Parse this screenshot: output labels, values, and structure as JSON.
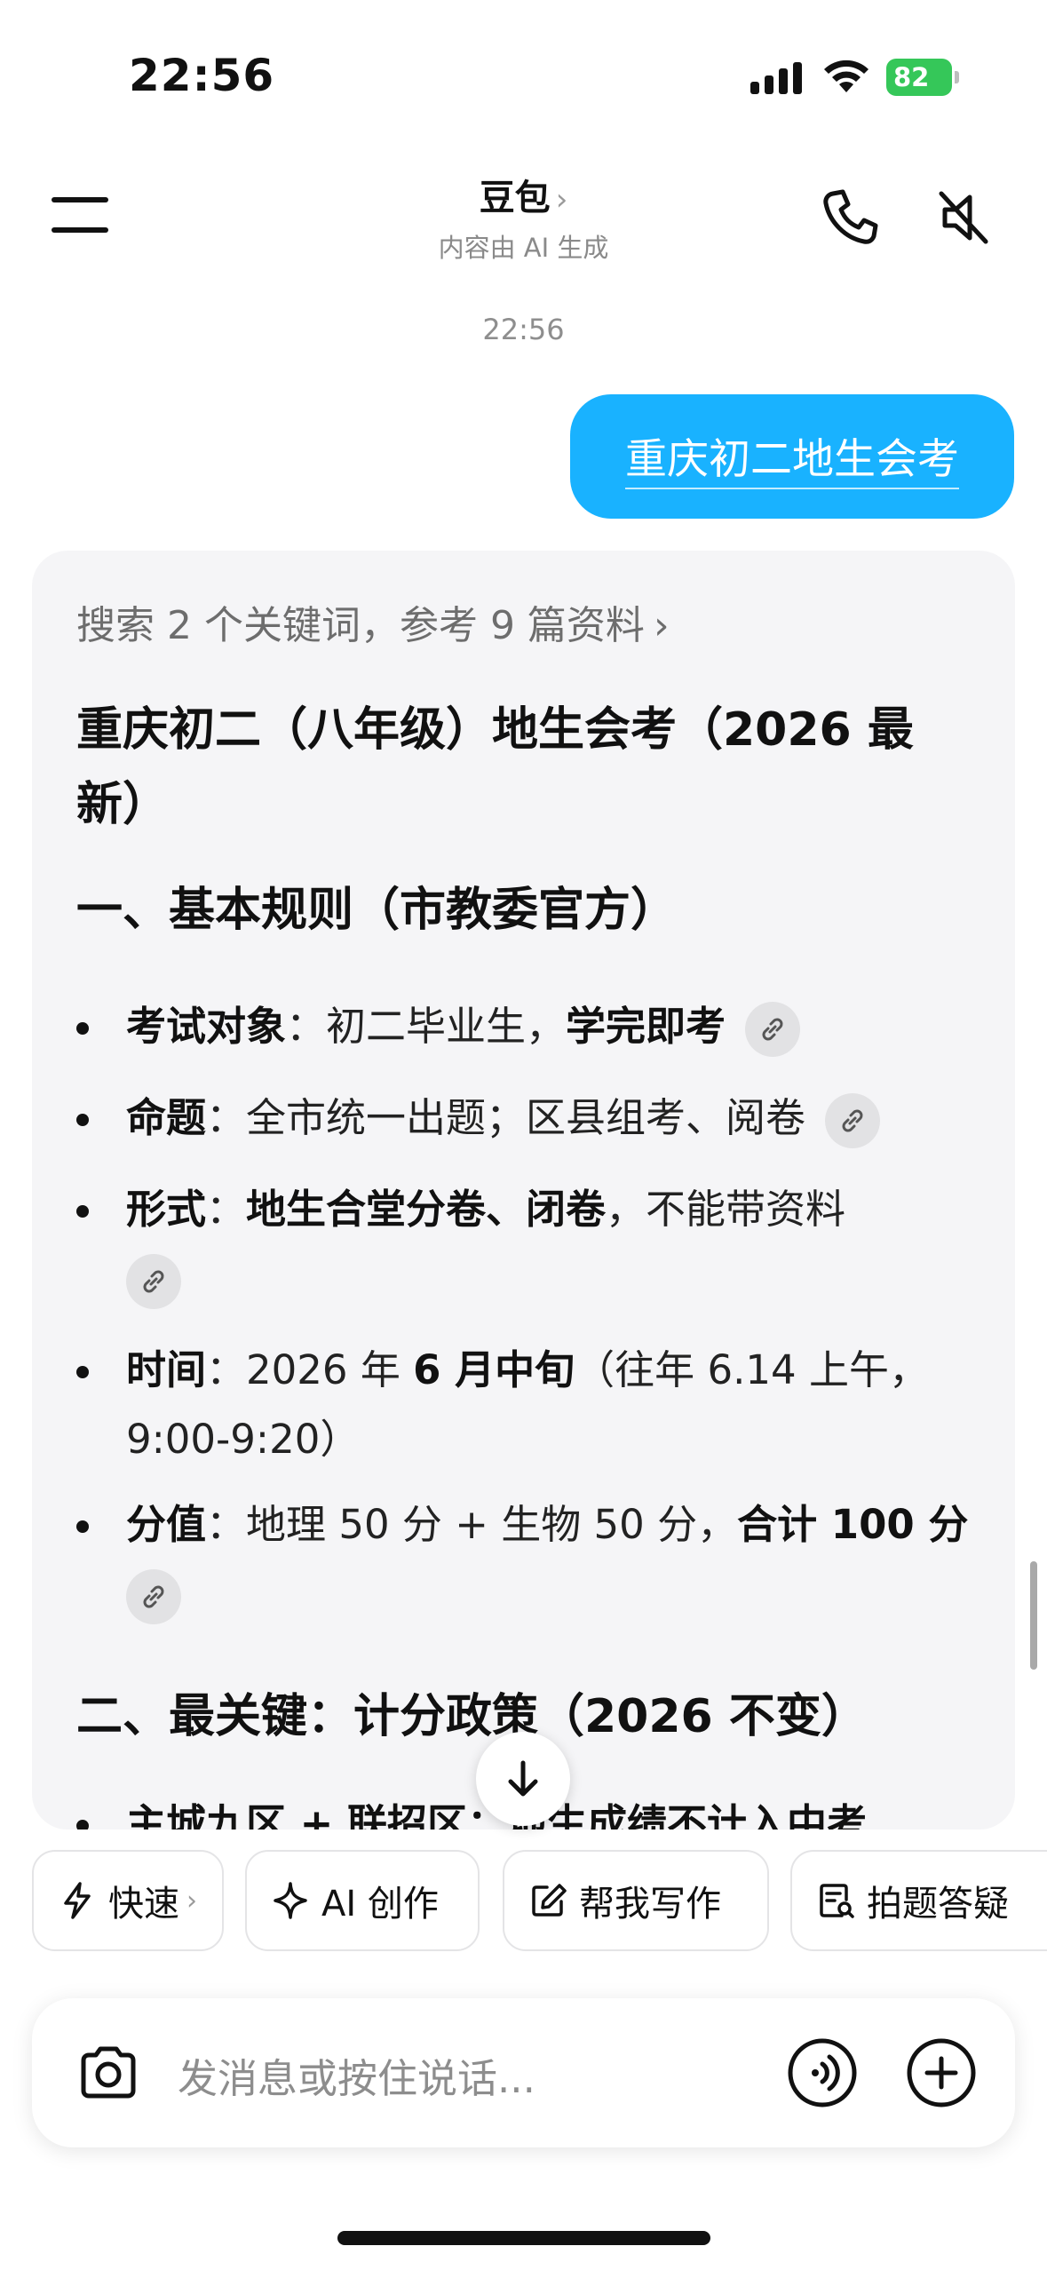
{
  "status_bar": {
    "time": "22:56",
    "battery": "82"
  },
  "header": {
    "title": "豆包",
    "title_chevron": "›",
    "subtitle": "内容由 AI 生成",
    "icons": [
      "menu-icon",
      "phone-icon",
      "mute-icon"
    ]
  },
  "chat": {
    "timestamp": "22:56",
    "user_message": "重庆初二地生会考",
    "answer": {
      "search_ref": "搜索 2 个关键词，参考 9 篇资料",
      "search_ref_chevron": "›",
      "heading": "重庆初二（八年级）地生会考（2026 最新）",
      "section1": "一、基本规则（市教委官方）",
      "bullets": [
        {
          "label": "考试对象",
          "sep": "：",
          "text1": "初二毕业生，",
          "bold1": "学完即考",
          "text2": ""
        },
        {
          "label": "命题",
          "sep": "：",
          "text1": "全市统一出题；区县组考、阅卷",
          "bold1": "",
          "text2": ""
        },
        {
          "label": "形式",
          "sep": "：",
          "text1": "",
          "bold1": "地生合堂分卷、闭卷",
          "text2": "，不能带资料"
        },
        {
          "label": "时间",
          "sep": "：",
          "text1": "2026 年 ",
          "bold1": "6 月中旬",
          "text2": "（往年 6.14 上午，9:00-9:20）"
        },
        {
          "label": "分值",
          "sep": "：",
          "text1": "地理 50 分 + 生物 50 分，",
          "bold1": "合计 100 分",
          "text2": ""
        }
      ],
      "section2": "二、最关键：计分政策（2026 不变）",
      "cut_line": "主城九区 + 联招区：地生成绩不计入中考"
    }
  },
  "quick_actions": [
    {
      "label": "快速",
      "icon": "lightning-icon",
      "chevron": "›"
    },
    {
      "label": "AI 创作",
      "icon": "sparkle-icon"
    },
    {
      "label": "帮我写作",
      "icon": "edit-icon"
    },
    {
      "label": "拍题答疑",
      "icon": "photo-question-icon"
    }
  ],
  "input": {
    "placeholder": "发消息或按住说话...",
    "icons": [
      "camera-icon",
      "voice-icon",
      "plus-icon"
    ]
  },
  "colors": {
    "accent": "#19b2ff",
    "battery": "#35c759",
    "card_bg": "#f5f5f7"
  }
}
